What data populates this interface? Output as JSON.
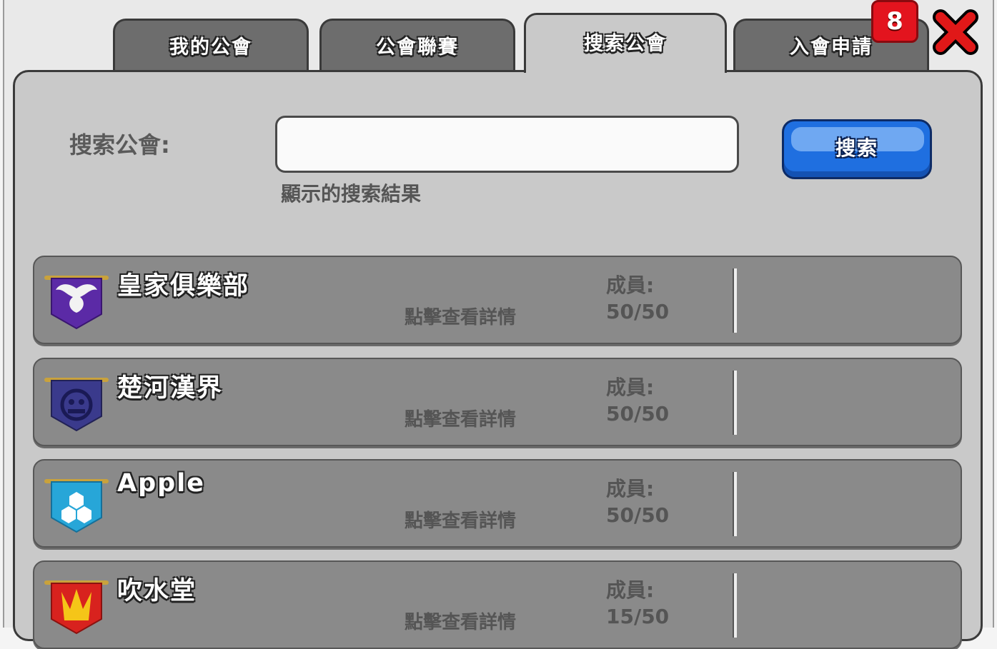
{
  "tabs": [
    {
      "label": "我的公會",
      "active": false
    },
    {
      "label": "公會聯賽",
      "active": false
    },
    {
      "label": "搜索公會",
      "active": true
    },
    {
      "label": "入會申請",
      "active": false
    }
  ],
  "notification_badge": "8",
  "search": {
    "label": "搜索公會:",
    "input_value": "",
    "placeholder": "",
    "button_label": "搜索",
    "results_label": "顯示的搜索結果"
  },
  "guilds": [
    {
      "name": "皇家俱樂部",
      "details": "點擊查看詳情",
      "members_label": "成員:",
      "members": "50/50",
      "emblem": "winged-emblem-icon",
      "emblem_color": "#5b2aa6"
    },
    {
      "name": "楚河漢界",
      "details": "點擊查看詳情",
      "members_label": "成員:",
      "members": "50/50",
      "emblem": "jolly-roger-emblem-icon",
      "emblem_color": "#3a3a8c"
    },
    {
      "name": "Apple",
      "details": "點擊查看詳情",
      "members_label": "成員:",
      "members": "50/50",
      "emblem": "hexagon-emblem-icon",
      "emblem_color": "#27a6d8"
    },
    {
      "name": "吹水堂",
      "details": "點擊查看詳情",
      "members_label": "成員:",
      "members": "15/50",
      "emblem": "crown-emblem-icon",
      "emblem_color": "#d8221e"
    }
  ]
}
